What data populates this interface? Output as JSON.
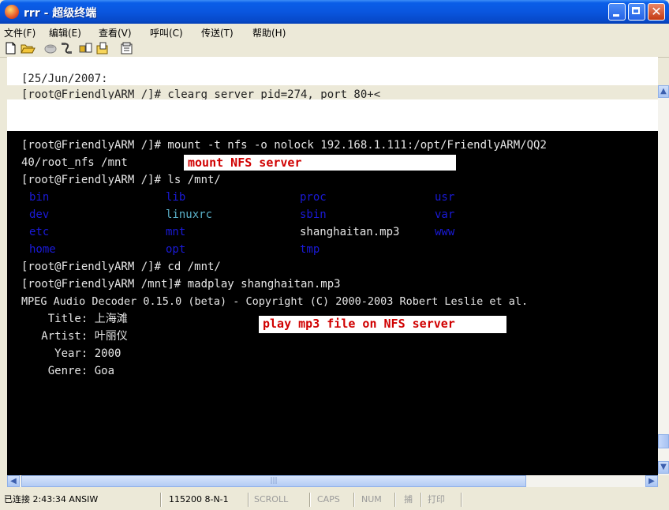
{
  "window": {
    "title": "rrr - 超级终端",
    "controls": {
      "minimize": "minimize",
      "maximize": "maximize",
      "close": "✕"
    }
  },
  "menu": [
    "文件(F)",
    "编辑(E)",
    "查看(V)",
    "呼叫(C)",
    "传送(T)",
    "帮助(H)"
  ],
  "toolbar_icons": [
    "new-icon",
    "open-icon",
    "disconnect-icon",
    "call-icon",
    "send-icon",
    "receive-icon",
    "properties-icon"
  ],
  "terminal": {
    "scrollback": [
      "[25/Jun/2007:",
      "[root@FriendlyARM /]# clearg server pid=274, port 80+<"
    ],
    "lines": [
      "[root@FriendlyARM /]# mount -t nfs -o nolock 192.168.1.111:/opt/FriendlyARM/QQ2",
      "40/root_nfs /mnt",
      "[root@FriendlyARM /]# ls /mnt/",
      "[root@FriendlyARM /]# cd /mnt/",
      "[root@FriendlyARM /mnt]# madplay shanghaitan.mp3",
      "MPEG Audio Decoder 0.15.0 (beta) - Copyright (C) 2000-2003 Robert Leslie et al.",
      "    Title: 上海滩",
      "   Artist: 叶丽仪",
      "     Year: 2000",
      "    Genre: Goa"
    ],
    "ls_rows": [
      [
        "bin",
        "lib",
        "proc",
        "usr"
      ],
      [
        "dev",
        "linuxrc",
        "sbin",
        "var"
      ],
      [
        "etc",
        "mnt",
        "shanghaitan.mp3",
        "www"
      ],
      [
        "home",
        "opt",
        "tmp",
        ""
      ]
    ],
    "colors": {
      "background": "#000000",
      "text": "#e6e6e6",
      "dir": "#1a1ad8",
      "link": "#5ab0c8",
      "annotation": "#d00000"
    }
  },
  "annotations": {
    "mount": "mount NFS server",
    "play": "play mp3 file on NFS server"
  },
  "status": {
    "connected": "已连接 2:43:34 ANSIW",
    "settings": "115200 8-N-1",
    "scroll": "SCROLL",
    "caps": "CAPS",
    "num": "NUM",
    "capture": "捕",
    "print": "打印"
  }
}
